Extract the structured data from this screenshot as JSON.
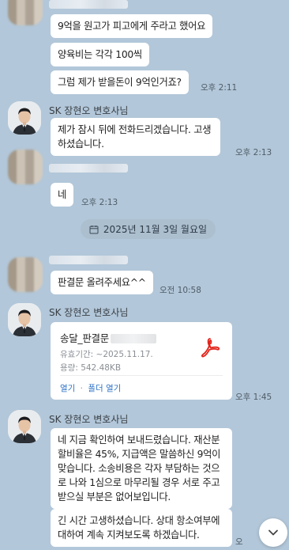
{
  "messages": {
    "m1": "9억을 원고가 피고에게  주라고 했어요",
    "m2": "양육비는 각각 100씩",
    "m3": "그럼 제가 받을돈이 9억인거죠?",
    "m3_time": "오후 2:11",
    "lawyer_name": "SK 장현오 변호사님",
    "m4": "제가 잠시 뒤에 전화드리겠습니다. 고생하셨습니다.",
    "m4_time": "오후 2:13",
    "m5": "네",
    "m5_time": "오후 2:13",
    "date_divider": "2025년 11월 3일 월요일",
    "m6": "판결문 올려주세요^^",
    "m6_time": "오전 10:58",
    "m7_time": "오후 1:45",
    "m8": "네 지금 확인하여 보내드렸습니다. 재산분할비율은 45%, 지급액은 말씀하신 9억이 맞습니다. 소송비용은 각자 부담하는 것으로 나와 1심으로 마무리될 경우 서로 주고받으실 부분은 없어보입니다.",
    "m9": "긴 시간 고생하셨습니다. 상대 항소여부에 대하여 계속 지켜보도록 하겠습니다.",
    "m9_time": "오"
  },
  "file": {
    "name": "송달_판결문",
    "expiry": "유효기간: ~2025.11.17.",
    "size": "용량: 542.48KB",
    "open": "열기",
    "separator": "·",
    "open_folder": "폴더 열기"
  },
  "colors": {
    "background": "#b2c7d9",
    "bubble": "#ffffff",
    "pdf_red": "#e2231a",
    "link_blue": "#2c72c7"
  },
  "icons": {
    "calendar": "calendar-icon",
    "pdf": "pdf-icon",
    "scroll_down": "chevron-down-icon"
  }
}
